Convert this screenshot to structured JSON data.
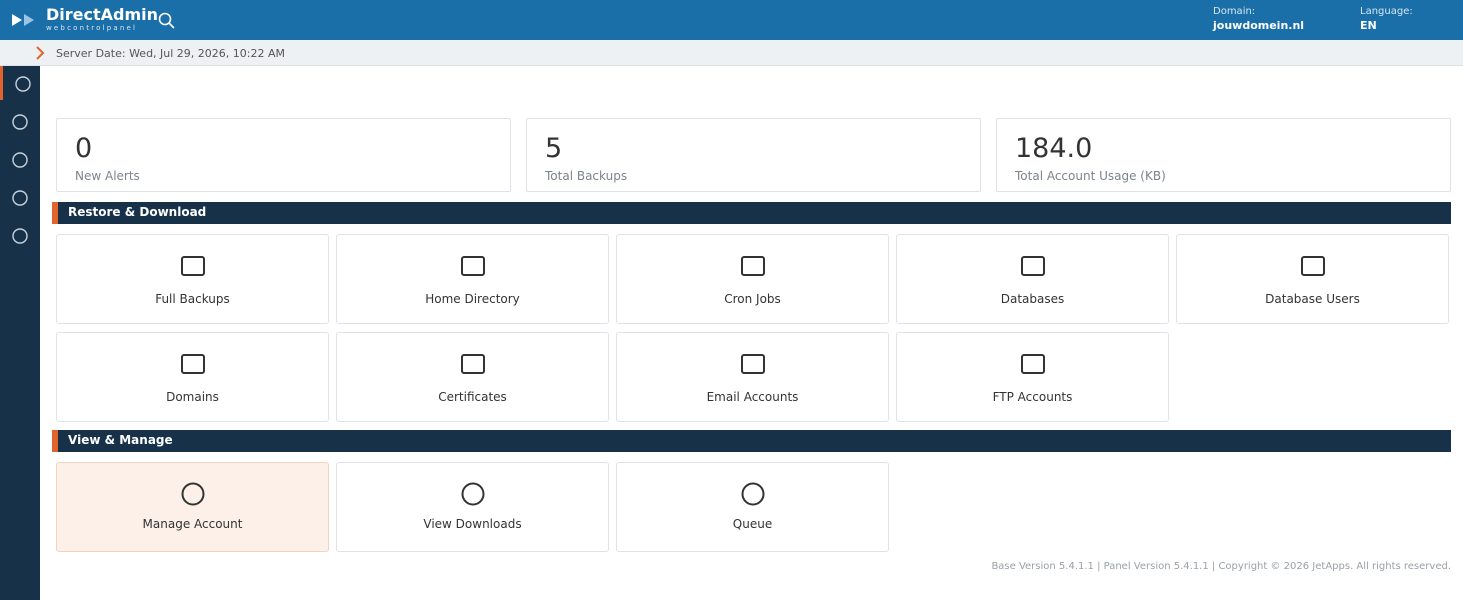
{
  "header": {
    "brand": "DirectAdmin",
    "brand_sub": "webcontrolpanel",
    "domain_label": "Domain:",
    "domain_value": "jouwdomein.nl",
    "language_label": "Language:",
    "language_value": "EN"
  },
  "subbar": {
    "server_date": "Server Date: Wed, Jul 29, 2026, 10:22 AM"
  },
  "sidebar": {
    "item_count": 5,
    "active_index": 0
  },
  "stats": [
    {
      "value": "0",
      "label": "New Alerts"
    },
    {
      "value": "5",
      "label": "Total Backups"
    },
    {
      "value": "184.0",
      "label": "Total Account Usage (KB)"
    }
  ],
  "sections": {
    "restore": {
      "title": "Restore & Download",
      "items": [
        {
          "label": "Full Backups",
          "icon": "square-icon"
        },
        {
          "label": "Home Directory",
          "icon": "square-icon"
        },
        {
          "label": "Cron Jobs",
          "icon": "square-icon"
        },
        {
          "label": "Databases",
          "icon": "square-icon"
        },
        {
          "label": "Database Users",
          "icon": "square-icon"
        },
        {
          "label": "Domains",
          "icon": "square-icon"
        },
        {
          "label": "Certificates",
          "icon": "square-icon"
        },
        {
          "label": "Email Accounts",
          "icon": "square-icon"
        },
        {
          "label": "FTP Accounts",
          "icon": "square-icon"
        }
      ]
    },
    "manage": {
      "title": "View & Manage",
      "items": [
        {
          "label": "Manage Account",
          "icon": "circle-icon",
          "highlighted": true
        },
        {
          "label": "View Downloads",
          "icon": "circle-icon"
        },
        {
          "label": "Queue",
          "icon": "circle-icon"
        }
      ]
    }
  },
  "footer": {
    "text": "Base Version 5.4.1.1 | Panel Version 5.4.1.1 | Copyright © 2026 JetApps. All rights reserved."
  },
  "colors": {
    "header": "#1b6fa8",
    "sidebar": "#173149",
    "accent": "#e0642b",
    "section": "#173149",
    "highlight_tile": "#fcf0e8"
  }
}
